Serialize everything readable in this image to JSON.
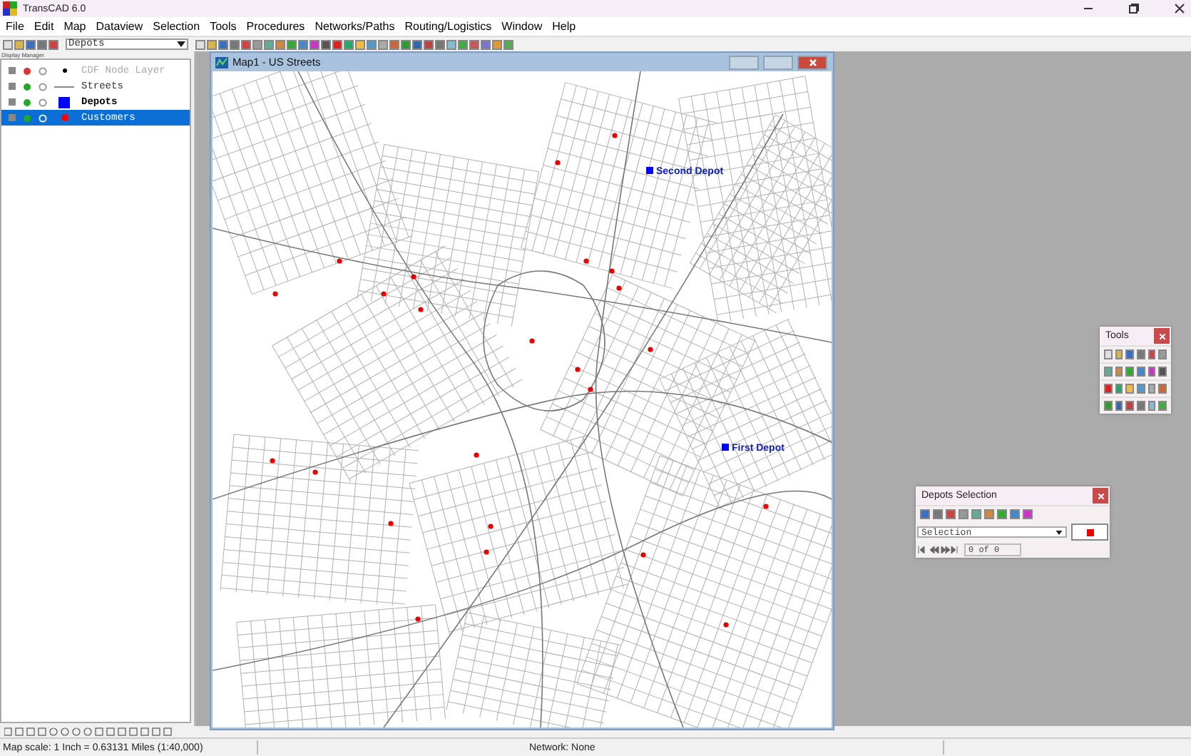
{
  "window": {
    "title": "TransCAD 6.0"
  },
  "menu": [
    "File",
    "Edit",
    "Map",
    "Dataview",
    "Selection",
    "Tools",
    "Procedures",
    "Networks/Paths",
    "Routing/Logistics",
    "Window",
    "Help"
  ],
  "toolbar": {
    "layer_dropdown": "Depots"
  },
  "display_manager": {
    "title": "Display Manager",
    "layers": [
      {
        "name": "CDF Node Layer",
        "kind": "node",
        "hidden": true,
        "working": false,
        "selected": false
      },
      {
        "name": "Streets",
        "kind": "line",
        "hidden": false,
        "working": false,
        "selected": false
      },
      {
        "name": "Depots",
        "kind": "square",
        "color": "#0000ff",
        "hidden": false,
        "working": true,
        "selected": false
      },
      {
        "name": "Customers",
        "kind": "dot",
        "color": "#ff0000",
        "hidden": false,
        "working": false,
        "selected": true
      }
    ]
  },
  "map_window": {
    "title": "Map1 - US Streets",
    "depots": [
      {
        "label": "Second Depot"
      },
      {
        "label": "First Depot"
      }
    ]
  },
  "tools_palette": {
    "title": "Tools"
  },
  "selection_toolbox": {
    "title": "Depots Selection",
    "set": "Selection",
    "count": "0 of 0"
  },
  "status_bar": {
    "scale": "Map scale: 1 Inch = 0.63131 Miles (1:40,000)",
    "network": "Network: None"
  }
}
